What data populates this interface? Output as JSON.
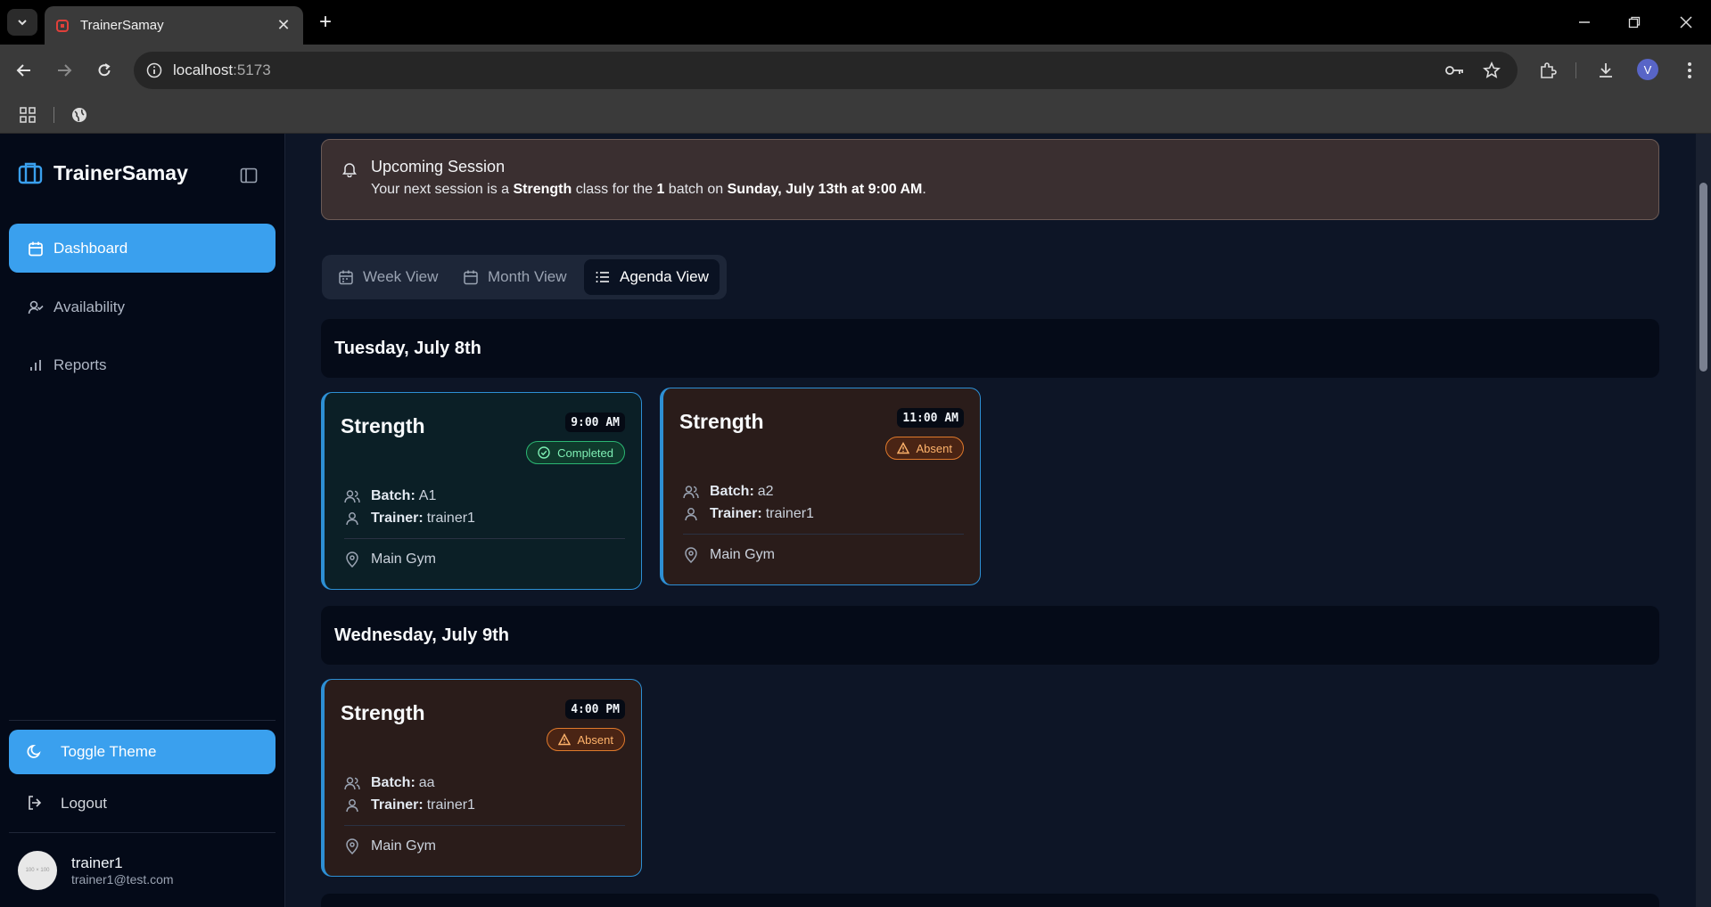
{
  "browser": {
    "tab_title": "TrainerSamay",
    "url_host": "localhost",
    "url_port": ":5173",
    "profile_initial": "V"
  },
  "app": {
    "brand": "TrainerSamay",
    "nav": [
      {
        "label": "Dashboard",
        "icon": "calendar-icon",
        "active": true
      },
      {
        "label": "Availability",
        "icon": "user-check-icon",
        "active": false
      },
      {
        "label": "Reports",
        "icon": "bar-chart-icon",
        "active": false
      }
    ],
    "toggle_theme": "Toggle Theme",
    "logout": "Logout",
    "user": {
      "name": "trainer1",
      "email": "trainer1@test.com",
      "avatar_text": "100 × 100"
    }
  },
  "banner": {
    "title": "Upcoming Session",
    "text_prefix": "Your next session is a ",
    "class_name": "Strength",
    "text_mid1": " class for the ",
    "batch": "1",
    "text_mid2": " batch on ",
    "when": "Sunday, July 13th at 9:00 AM",
    "text_suffix": "."
  },
  "views": [
    {
      "label": "Week View",
      "icon": "calendar-icon"
    },
    {
      "label": "Month View",
      "icon": "calendar-icon"
    },
    {
      "label": "Agenda View",
      "icon": "list-icon",
      "active": true
    }
  ],
  "days": [
    {
      "label": "Tuesday, July 8th",
      "sessions": [
        {
          "title": "Strength",
          "time": "9:00 AM",
          "status": "Completed",
          "batch_label": "Batch:",
          "batch": "A1",
          "trainer_label": "Trainer:",
          "trainer": "trainer1",
          "location": "Main Gym"
        },
        {
          "title": "Strength",
          "time": "11:00 AM",
          "status": "Absent",
          "batch_label": "Batch:",
          "batch": "a2",
          "trainer_label": "Trainer:",
          "trainer": "trainer1",
          "location": "Main Gym"
        }
      ]
    },
    {
      "label": "Wednesday, July 9th",
      "sessions": [
        {
          "title": "Strength",
          "time": "4:00 PM",
          "status": "Absent",
          "batch_label": "Batch:",
          "batch": "aa",
          "trainer_label": "Trainer:",
          "trainer": "trainer1",
          "location": "Main Gym"
        }
      ]
    }
  ],
  "colors": {
    "accent": "#3aa0ee",
    "completed": "#2bb673",
    "absent": "#e07a2c"
  }
}
